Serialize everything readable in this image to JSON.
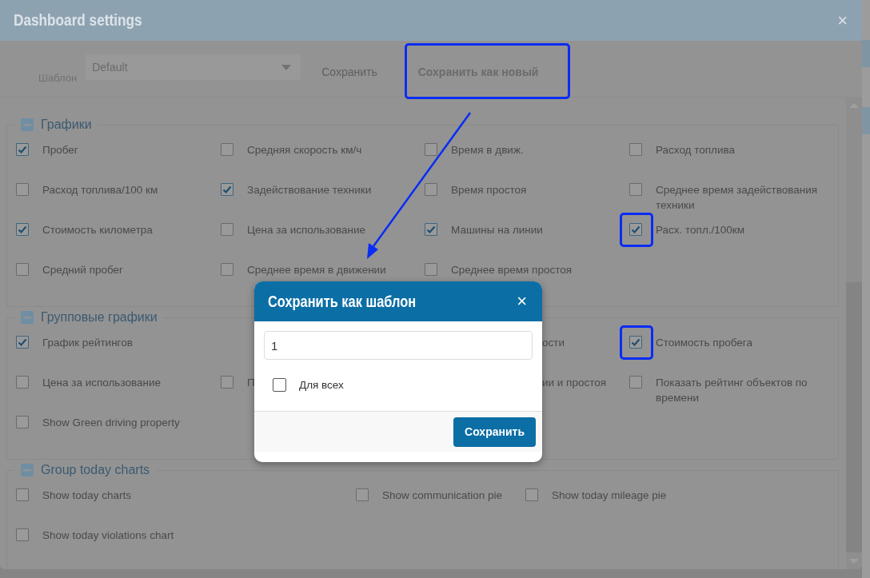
{
  "window": {
    "title": "Dashboard settings",
    "close": "×"
  },
  "toolbar": {
    "template_label": "Шаблон",
    "template_value": "Default",
    "buttons": [
      {
        "label": "Сохранить",
        "disabled": true,
        "highlighted": false
      },
      {
        "label": "Сохранить как новый",
        "disabled": false,
        "highlighted": true
      }
    ]
  },
  "sections": [
    {
      "title": "Графики",
      "kind": "quad",
      "rows": [
        [
          {
            "label": "Пробег",
            "checked": true,
            "highlighted": false
          },
          {
            "label": "Средняя скорость км/ч",
            "checked": false,
            "highlighted": false
          },
          {
            "label": "Время в движ.",
            "checked": false,
            "highlighted": false
          },
          {
            "label": "Расход топлива",
            "checked": false,
            "highlighted": false
          }
        ],
        [
          {
            "label": "Расход топлива/100 км",
            "checked": false,
            "highlighted": false
          },
          {
            "label": "Задействование техники",
            "checked": true,
            "highlighted": false
          },
          {
            "label": "Время простоя",
            "checked": false,
            "highlighted": false
          },
          {
            "label": "Среднее время задействования техники",
            "checked": false,
            "highlighted": false
          }
        ],
        [
          {
            "label": "Стоимость километра",
            "checked": true,
            "highlighted": false
          },
          {
            "label": "Цена за использование",
            "checked": false,
            "highlighted": false
          },
          {
            "label": "Машины на линии",
            "checked": true,
            "highlighted": false
          },
          {
            "label": "Расх. топл./100км",
            "checked": true,
            "highlighted": true
          }
        ],
        [
          {
            "label": "Средний пробег",
            "checked": false,
            "highlighted": false
          },
          {
            "label": "Среднее время в движении",
            "checked": false,
            "highlighted": false
          },
          {
            "label": "Среднее время простоя",
            "checked": false,
            "highlighted": false
          }
        ]
      ]
    },
    {
      "title": "Групповые графики",
      "kind": "quad",
      "rows": [
        [
          {
            "label": "График рейтингов",
            "checked": true,
            "highlighted": false
          },
          null,
          {
            "label": "ости",
            "kind": "tail"
          },
          {
            "label": "Стоимость пробега",
            "checked": true,
            "highlighted": true
          }
        ],
        [
          {
            "label": "Цена за использование",
            "checked": false,
            "highlighted": false
          },
          {
            "label": "П",
            "checked": false,
            "highlighted": false
          },
          {
            "label": "ии и простоя",
            "kind": "tail"
          },
          {
            "label": "Показать рейтинг объектов по времени",
            "checked": false,
            "highlighted": false
          }
        ],
        [
          {
            "label": "Show Green driving property",
            "checked": false,
            "highlighted": false
          }
        ]
      ]
    },
    {
      "title": "Group today charts",
      "kind": "today",
      "rows": [
        [
          {
            "label": "Show today charts",
            "checked": false,
            "highlighted": false
          },
          {
            "label": "Show communication pie",
            "checked": false,
            "highlighted": false
          },
          {
            "label": "Show today mileage pie",
            "checked": false,
            "highlighted": false
          }
        ],
        [
          {
            "label": "Show today violations chart",
            "checked": false,
            "highlighted": false
          }
        ]
      ]
    }
  ],
  "modal": {
    "title": "Сохранить как шаблон",
    "close": "×",
    "name_value": "1",
    "for_all": {
      "label": "Для всех",
      "checked": false
    },
    "save": "Сохранить"
  }
}
